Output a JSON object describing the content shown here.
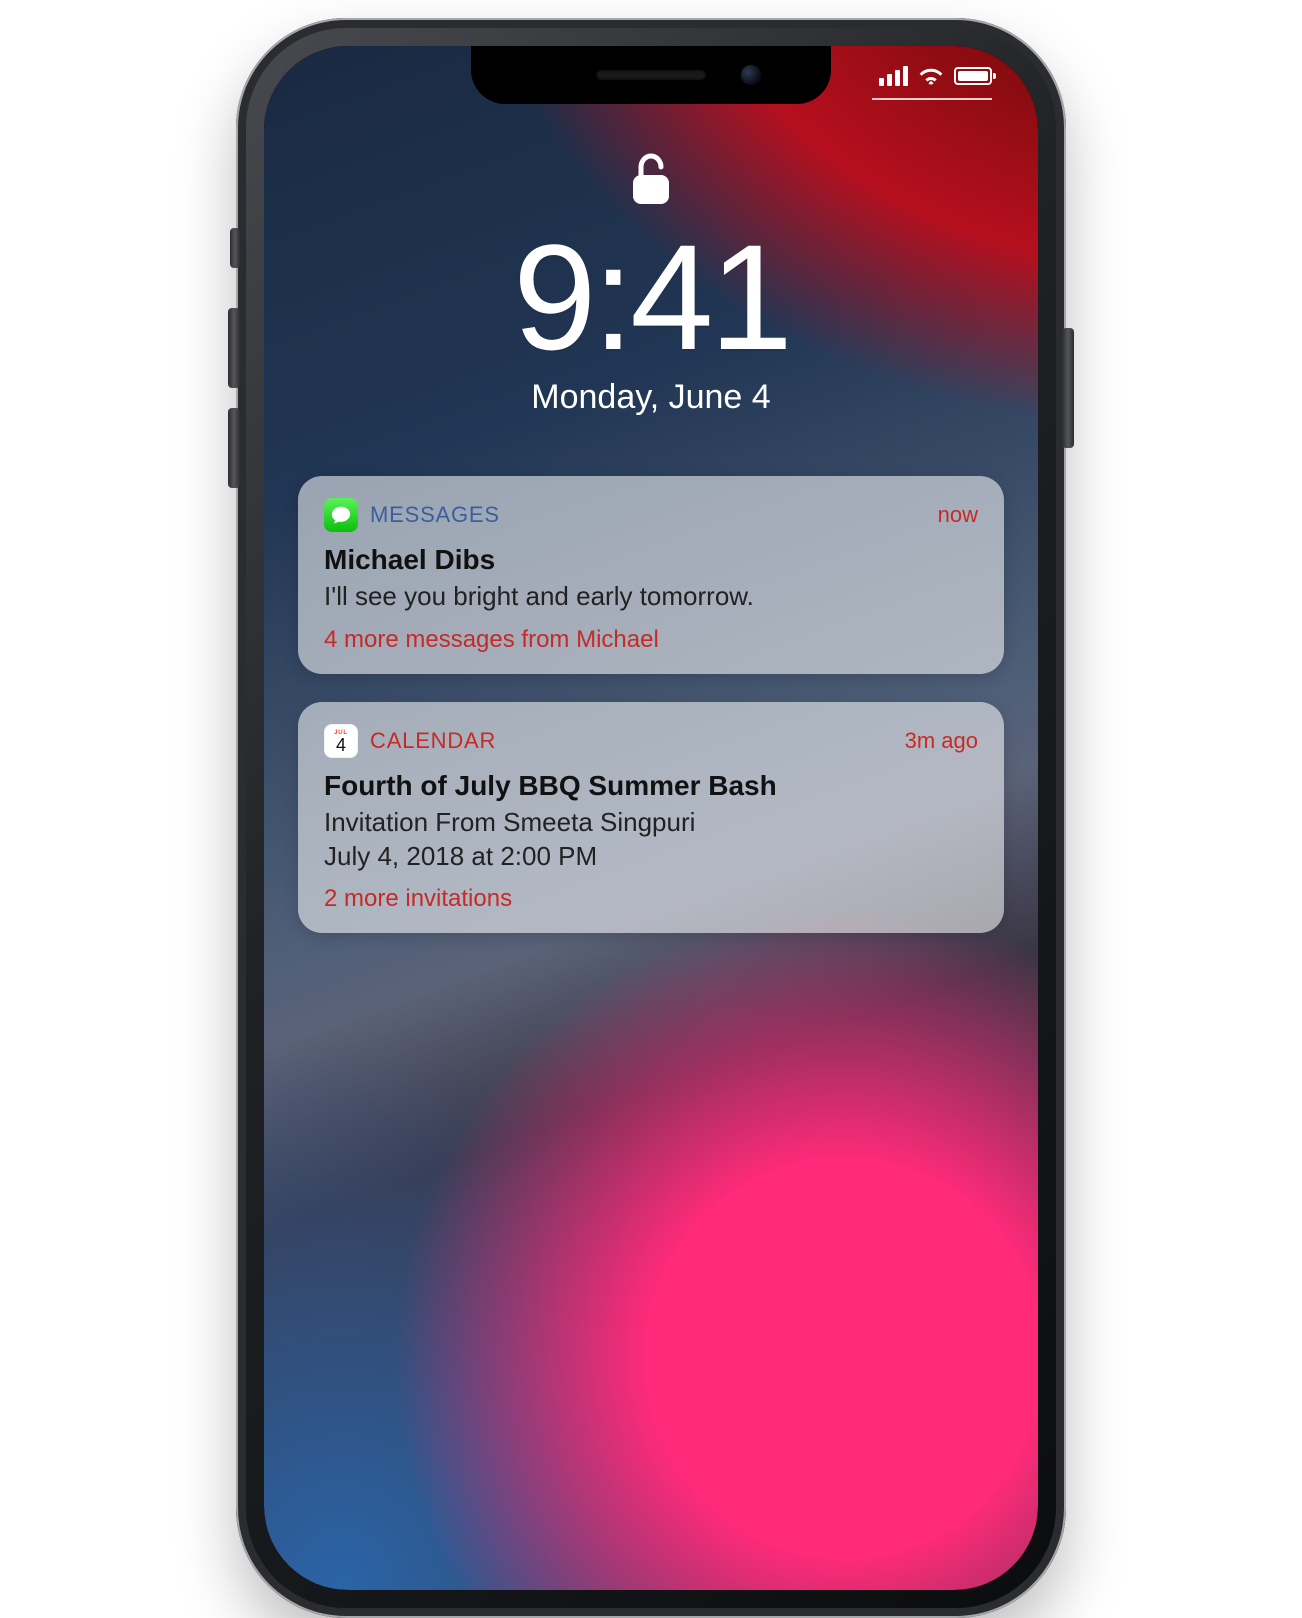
{
  "lockscreen": {
    "time": "9:41",
    "date": "Monday, June 4"
  },
  "notifications": [
    {
      "app_label": "MESSAGES",
      "time": "now",
      "title": "Michael Dibs",
      "body": "I'll see you bright and early tomorrow.",
      "more": "4 more messages from Michael",
      "icon": "messages-icon"
    },
    {
      "app_label": "CALENDAR",
      "time": "3m ago",
      "title": "Fourth of July BBQ Summer Bash",
      "body": "Invitation From Smeeta Singpuri\nJuly 4, 2018 at 2:00 PM",
      "more": "2 more invitations",
      "icon": "calendar-icon",
      "calendar_day": "4"
    }
  ]
}
